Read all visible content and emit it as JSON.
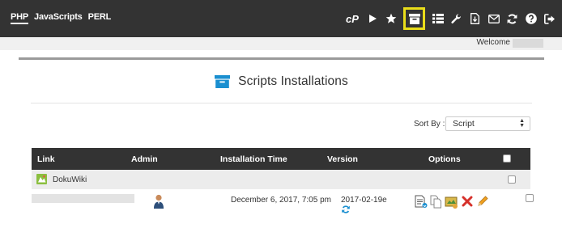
{
  "topbar": {
    "languages": [
      {
        "label": "PHP",
        "active": true
      },
      {
        "label": "JavaScripts",
        "active": false
      },
      {
        "label": "PERL",
        "active": false
      }
    ],
    "icons": [
      "cpanel-icon",
      "play-icon",
      "star-icon",
      "archive-box-icon",
      "list-icon",
      "wrench-icon",
      "download-file-icon",
      "envelope-icon",
      "refresh-icon",
      "help-icon",
      "logout-icon"
    ],
    "cpanel_glyph": "cP",
    "highlight_color": "#e9dd1a"
  },
  "welcome": {
    "text": "Welcome"
  },
  "page": {
    "title": "Scripts Installations",
    "accent_color": "#1a8fd0"
  },
  "sort": {
    "label": "Sort By :",
    "selected": "Script"
  },
  "table": {
    "headers": {
      "link": "Link",
      "admin": "Admin",
      "installation_time": "Installation Time",
      "version": "Version",
      "options": "Options"
    },
    "group": {
      "name": "DokuWiki"
    },
    "rows": [
      {
        "installation_time": "December 6, 2017, 7:05 pm",
        "version": "2017-02-19e"
      }
    ]
  }
}
